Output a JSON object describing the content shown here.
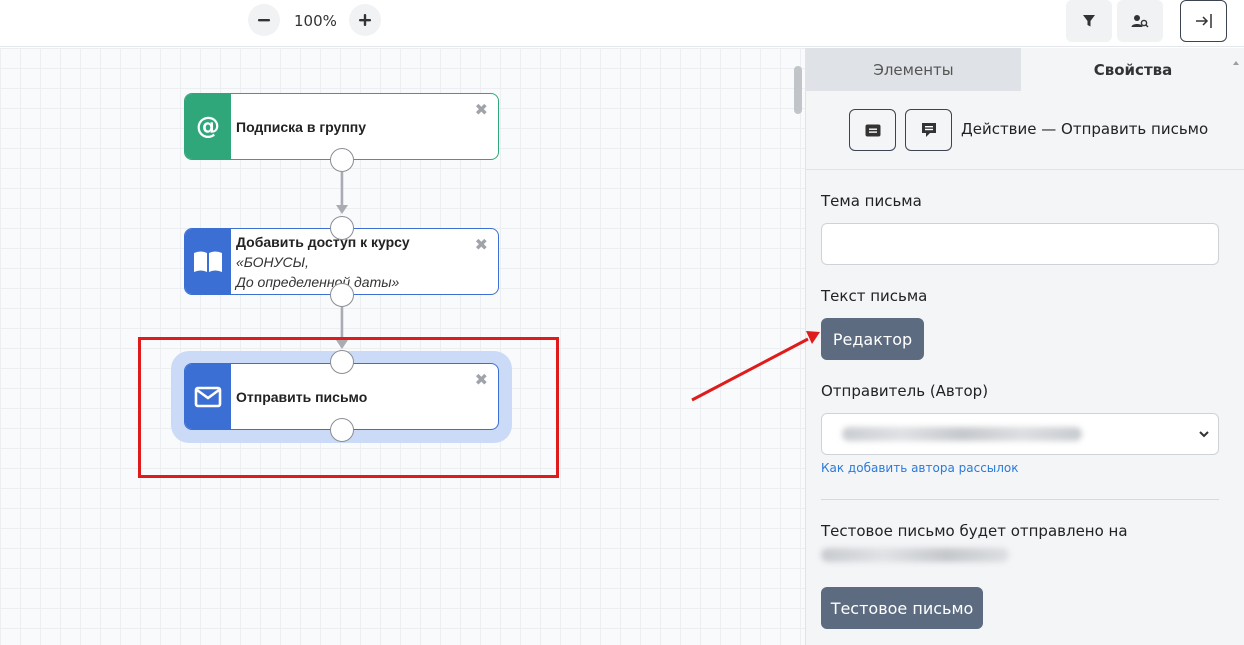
{
  "toolbar": {
    "zoom_level": "100%",
    "zoom_out_icon": "minus-icon",
    "zoom_in_icon": "plus-icon",
    "filter_icon": "filter-icon",
    "user_search_icon": "user-search-icon",
    "exit_icon": "arrow-right-to-line-icon"
  },
  "canvas": {
    "nodes": [
      {
        "icon": "at-icon",
        "color": "#2fa77a",
        "title": "Подписка в группу",
        "subtitle": ""
      },
      {
        "icon": "book-icon",
        "color": "#3b6fd4",
        "title": "Добавить доступ к курсу",
        "subtitle": "«БОНУСЫ,",
        "subtitle2": "До определенной даты»"
      },
      {
        "icon": "envelope-icon",
        "color": "#3b6fd4",
        "title": "Отправить письмо",
        "subtitle": ""
      }
    ],
    "close_symbol": "✖"
  },
  "panel": {
    "tabs": [
      {
        "label": "Элементы",
        "active": false
      },
      {
        "label": "Свойства",
        "active": true
      }
    ],
    "action_title": "Действие — Отправить письмо",
    "subject_label": "Тема письма",
    "subject_value": "",
    "body_label": "Текст письма",
    "editor_button": "Редактор",
    "sender_label": "Отправитель (Автор)",
    "sender_link": "Как добавить автора рассылок",
    "test_label": "Тестовое письмо будет отправлено на",
    "test_button": "Тестовое письмо"
  },
  "colors": {
    "annotation_red": "#e01b1b",
    "button_dark": "#5d6b80"
  }
}
